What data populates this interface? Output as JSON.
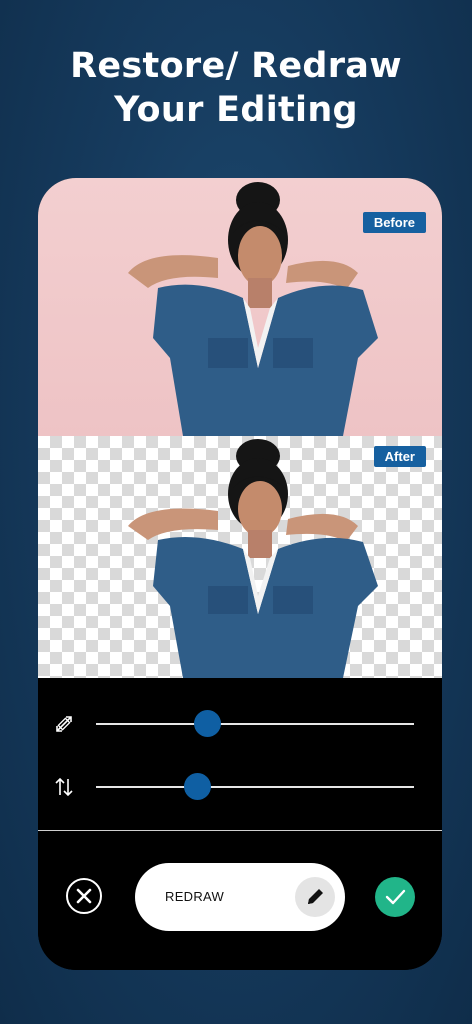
{
  "headline": {
    "line1": "Restore/ Redraw",
    "line2": "Your Editing"
  },
  "preview": {
    "before_label": "Before",
    "after_label": "After"
  },
  "sliders": [
    {
      "icon": "brush-size-icon",
      "value": 0.35
    },
    {
      "icon": "opacity-swap-icon",
      "value": 0.32
    }
  ],
  "actions": {
    "cancel_icon": "close-icon",
    "mode_label": "REDRAW",
    "mode_icon": "pencil-icon",
    "confirm_icon": "checkmark-icon"
  },
  "colors": {
    "accent": "#0f5fa3",
    "confirm": "#21b589",
    "background": "#163b5e"
  }
}
